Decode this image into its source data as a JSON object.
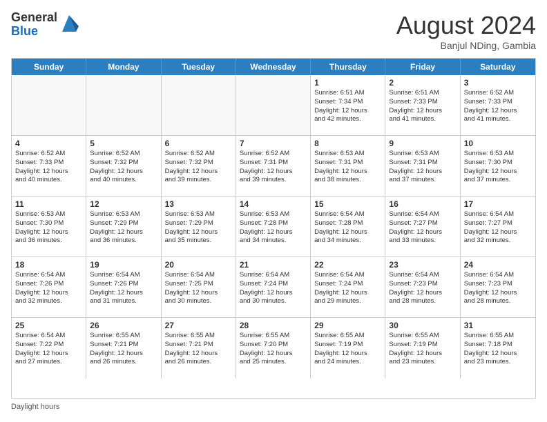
{
  "logo": {
    "general": "General",
    "blue": "Blue"
  },
  "title": "August 2024",
  "location": "Banjul NDing, Gambia",
  "days_of_week": [
    "Sunday",
    "Monday",
    "Tuesday",
    "Wednesday",
    "Thursday",
    "Friday",
    "Saturday"
  ],
  "footer_text": "Daylight hours",
  "weeks": [
    [
      {
        "day": "",
        "info": ""
      },
      {
        "day": "",
        "info": ""
      },
      {
        "day": "",
        "info": ""
      },
      {
        "day": "",
        "info": ""
      },
      {
        "day": "1",
        "info": "Sunrise: 6:51 AM\nSunset: 7:34 PM\nDaylight: 12 hours\nand 42 minutes."
      },
      {
        "day": "2",
        "info": "Sunrise: 6:51 AM\nSunset: 7:33 PM\nDaylight: 12 hours\nand 41 minutes."
      },
      {
        "day": "3",
        "info": "Sunrise: 6:52 AM\nSunset: 7:33 PM\nDaylight: 12 hours\nand 41 minutes."
      }
    ],
    [
      {
        "day": "4",
        "info": "Sunrise: 6:52 AM\nSunset: 7:33 PM\nDaylight: 12 hours\nand 40 minutes."
      },
      {
        "day": "5",
        "info": "Sunrise: 6:52 AM\nSunset: 7:32 PM\nDaylight: 12 hours\nand 40 minutes."
      },
      {
        "day": "6",
        "info": "Sunrise: 6:52 AM\nSunset: 7:32 PM\nDaylight: 12 hours\nand 39 minutes."
      },
      {
        "day": "7",
        "info": "Sunrise: 6:52 AM\nSunset: 7:31 PM\nDaylight: 12 hours\nand 39 minutes."
      },
      {
        "day": "8",
        "info": "Sunrise: 6:53 AM\nSunset: 7:31 PM\nDaylight: 12 hours\nand 38 minutes."
      },
      {
        "day": "9",
        "info": "Sunrise: 6:53 AM\nSunset: 7:31 PM\nDaylight: 12 hours\nand 37 minutes."
      },
      {
        "day": "10",
        "info": "Sunrise: 6:53 AM\nSunset: 7:30 PM\nDaylight: 12 hours\nand 37 minutes."
      }
    ],
    [
      {
        "day": "11",
        "info": "Sunrise: 6:53 AM\nSunset: 7:30 PM\nDaylight: 12 hours\nand 36 minutes."
      },
      {
        "day": "12",
        "info": "Sunrise: 6:53 AM\nSunset: 7:29 PM\nDaylight: 12 hours\nand 36 minutes."
      },
      {
        "day": "13",
        "info": "Sunrise: 6:53 AM\nSunset: 7:29 PM\nDaylight: 12 hours\nand 35 minutes."
      },
      {
        "day": "14",
        "info": "Sunrise: 6:53 AM\nSunset: 7:28 PM\nDaylight: 12 hours\nand 34 minutes."
      },
      {
        "day": "15",
        "info": "Sunrise: 6:54 AM\nSunset: 7:28 PM\nDaylight: 12 hours\nand 34 minutes."
      },
      {
        "day": "16",
        "info": "Sunrise: 6:54 AM\nSunset: 7:27 PM\nDaylight: 12 hours\nand 33 minutes."
      },
      {
        "day": "17",
        "info": "Sunrise: 6:54 AM\nSunset: 7:27 PM\nDaylight: 12 hours\nand 32 minutes."
      }
    ],
    [
      {
        "day": "18",
        "info": "Sunrise: 6:54 AM\nSunset: 7:26 PM\nDaylight: 12 hours\nand 32 minutes."
      },
      {
        "day": "19",
        "info": "Sunrise: 6:54 AM\nSunset: 7:26 PM\nDaylight: 12 hours\nand 31 minutes."
      },
      {
        "day": "20",
        "info": "Sunrise: 6:54 AM\nSunset: 7:25 PM\nDaylight: 12 hours\nand 30 minutes."
      },
      {
        "day": "21",
        "info": "Sunrise: 6:54 AM\nSunset: 7:24 PM\nDaylight: 12 hours\nand 30 minutes."
      },
      {
        "day": "22",
        "info": "Sunrise: 6:54 AM\nSunset: 7:24 PM\nDaylight: 12 hours\nand 29 minutes."
      },
      {
        "day": "23",
        "info": "Sunrise: 6:54 AM\nSunset: 7:23 PM\nDaylight: 12 hours\nand 28 minutes."
      },
      {
        "day": "24",
        "info": "Sunrise: 6:54 AM\nSunset: 7:23 PM\nDaylight: 12 hours\nand 28 minutes."
      }
    ],
    [
      {
        "day": "25",
        "info": "Sunrise: 6:54 AM\nSunset: 7:22 PM\nDaylight: 12 hours\nand 27 minutes."
      },
      {
        "day": "26",
        "info": "Sunrise: 6:55 AM\nSunset: 7:21 PM\nDaylight: 12 hours\nand 26 minutes."
      },
      {
        "day": "27",
        "info": "Sunrise: 6:55 AM\nSunset: 7:21 PM\nDaylight: 12 hours\nand 26 minutes."
      },
      {
        "day": "28",
        "info": "Sunrise: 6:55 AM\nSunset: 7:20 PM\nDaylight: 12 hours\nand 25 minutes."
      },
      {
        "day": "29",
        "info": "Sunrise: 6:55 AM\nSunset: 7:19 PM\nDaylight: 12 hours\nand 24 minutes."
      },
      {
        "day": "30",
        "info": "Sunrise: 6:55 AM\nSunset: 7:19 PM\nDaylight: 12 hours\nand 23 minutes."
      },
      {
        "day": "31",
        "info": "Sunrise: 6:55 AM\nSunset: 7:18 PM\nDaylight: 12 hours\nand 23 minutes."
      }
    ]
  ]
}
